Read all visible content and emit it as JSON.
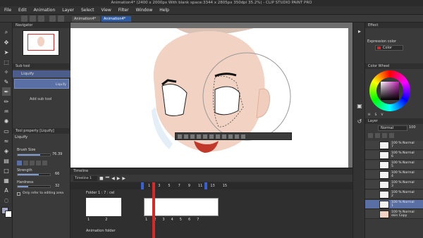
{
  "window": {
    "title": "Animation4* (2400 x 2000px With blank space:3344 x 2805px 350dpi 35.2%) - CLIP STUDIO PAINT PRO"
  },
  "menu": [
    "File",
    "Edit",
    "Animation",
    "Layer",
    "Select",
    "View",
    "Filter",
    "Window",
    "Help"
  ],
  "tabs": [
    "Animation4*"
  ],
  "navigator": {
    "title": "Navigator"
  },
  "subtool": {
    "header": "Sub tool",
    "selected": "Liquify",
    "item_label": "Liquify",
    "add_label": "Add sub tool"
  },
  "tool_property": {
    "header": "Tool property [Liquify]",
    "name": "Liquify",
    "brush_size_label": "Brush Size",
    "brush_size_value": "76.39",
    "strength_label": "Strength",
    "strength_value": "66",
    "hardness_label": "Hardness",
    "hardness_value": "32",
    "checkbox_label": "Only refer to editing area"
  },
  "effect": {
    "header": "Effect",
    "expression_label": "Expression color",
    "expression_value": "Color"
  },
  "color_wheel": {
    "header": "Color Wheel",
    "h": "H",
    "s": "S",
    "v": "V"
  },
  "layers": {
    "header": "Layer",
    "blend": "Normal",
    "opacity": "100",
    "rows": [
      {
        "line1": "100 % Normal",
        "line2": "7"
      },
      {
        "line1": "100 % Normal",
        "line2": "6"
      },
      {
        "line1": "100 % Normal",
        "line2": "5"
      },
      {
        "line1": "100 % Normal",
        "line2": "4"
      },
      {
        "line1": "100 % Normal",
        "line2": "3"
      },
      {
        "line1": "100 % Normal",
        "line2": "2"
      },
      {
        "line1": "100 % Normal",
        "line2": "1"
      },
      {
        "line1": "100 % Normal",
        "line2": "skin Copy"
      }
    ]
  },
  "timeline": {
    "header": "Timeline",
    "name": "Timeline 1",
    "track1": "Folder 1 : 7 : cel",
    "track2": "Animation folder",
    "frame_numbers": [
      "1",
      "3",
      "5",
      "7",
      "9",
      "11",
      "13",
      "15"
    ],
    "cels": [
      "1",
      "2",
      "3",
      "4",
      "5",
      "6",
      "7"
    ]
  },
  "colors": {
    "skin": "#f2d3c3",
    "accent_red": "#d62a2a",
    "playhead_blue": "#3a5fcf"
  }
}
